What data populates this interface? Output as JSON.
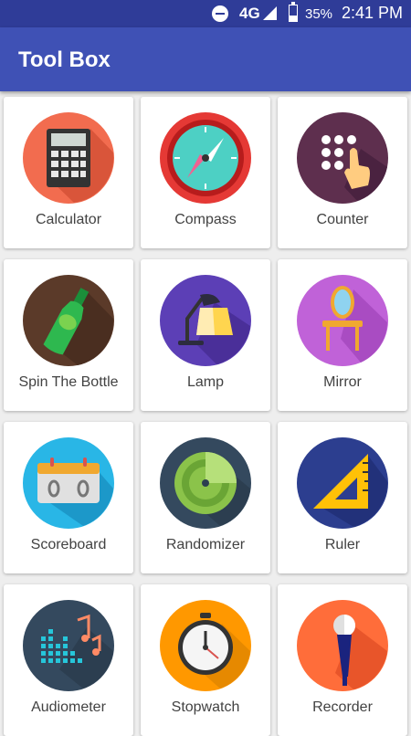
{
  "status_bar": {
    "network": "4G",
    "battery": "35%",
    "battery_level": 0.35,
    "time": "2:41 PM"
  },
  "app_bar": {
    "title": "Tool Box"
  },
  "tools": [
    {
      "label": "Calculator"
    },
    {
      "label": "Compass"
    },
    {
      "label": "Counter"
    },
    {
      "label": "Spin The Bottle"
    },
    {
      "label": "Lamp"
    },
    {
      "label": "Mirror"
    },
    {
      "label": "Scoreboard"
    },
    {
      "label": "Randomizer"
    },
    {
      "label": "Ruler"
    },
    {
      "label": "Audiometer"
    },
    {
      "label": "Stopwatch"
    },
    {
      "label": "Recorder"
    }
  ],
  "icons": {
    "calculator": "calculator-icon",
    "compass": "compass-icon",
    "counter": "counter-icon",
    "bottle": "bottle-icon",
    "lamp": "lamp-icon",
    "mirror": "mirror-icon",
    "scoreboard": "scoreboard-icon",
    "randomizer": "radar-icon",
    "ruler": "ruler-icon",
    "audiometer": "audiometer-icon",
    "stopwatch": "stopwatch-icon",
    "recorder": "microphone-icon"
  },
  "colors": {
    "status_bar": "#2f3c98",
    "app_bar": "#3f51b5",
    "calculator": "#f26c4f",
    "compass": "#e53935",
    "counter": "#5e2f4e",
    "bottle": "#5b3a29",
    "lamp": "#5c3fb6",
    "mirror": "#c062d8",
    "scoreboard": "#29b6e6",
    "randomizer": "#34495e",
    "ruler": "#2c3e8f",
    "audiometer": "#34495e",
    "stopwatch": "#ff9800",
    "recorder": "#ff6d3a"
  }
}
